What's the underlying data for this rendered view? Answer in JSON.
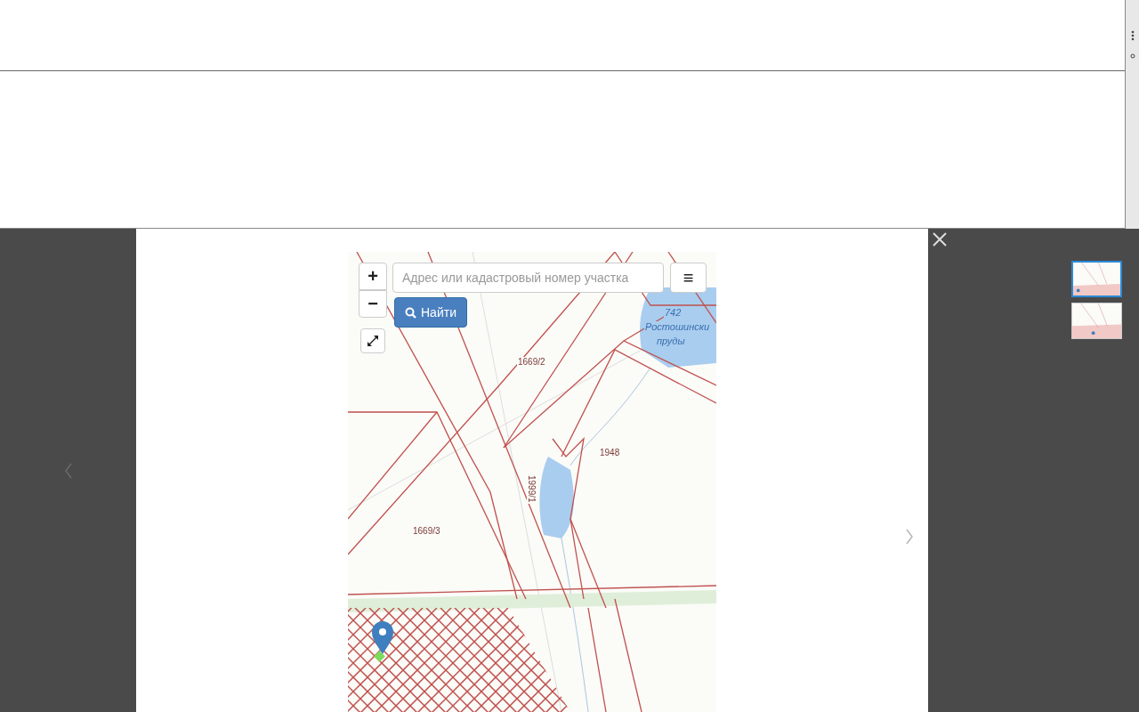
{
  "map": {
    "zoom_in": "+",
    "zoom_out": "−",
    "search": {
      "placeholder": "Адрес или кадастровый номер участка"
    },
    "menu": "≡",
    "find_button": "Найти",
    "labels": [
      {
        "kind": "parcel",
        "text": "1669/2"
      },
      {
        "kind": "water",
        "text": "742"
      },
      {
        "kind": "water",
        "text": "Ростошински"
      },
      {
        "kind": "water",
        "text": "пруды"
      },
      {
        "kind": "parcel",
        "text": "1948"
      },
      {
        "kind": "parcel-vertical",
        "text": "1999/1"
      },
      {
        "kind": "parcel",
        "text": "1669/3"
      }
    ]
  },
  "thumbnails": [
    {
      "selected": true
    },
    {
      "selected": false
    }
  ]
}
